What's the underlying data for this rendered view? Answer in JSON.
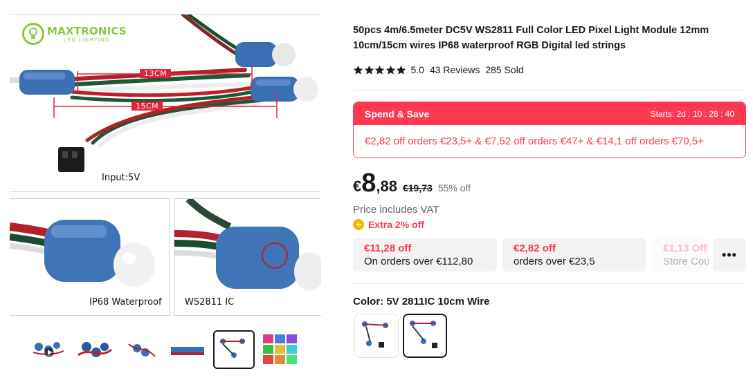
{
  "gallery": {
    "logo_name": "MAXTRONICS",
    "logo_sub": "LED LIGHTING",
    "dim_short": "13CM",
    "dim_long": "15CM",
    "input_caption": "Input:5V",
    "caption_left": "IP68 Waterproof",
    "caption_right": "WS2811 IC",
    "thumbnails": [
      {
        "name": "thumb-1",
        "video": true
      },
      {
        "name": "thumb-2"
      },
      {
        "name": "thumb-3"
      },
      {
        "name": "thumb-4"
      },
      {
        "name": "thumb-5",
        "active": true
      },
      {
        "name": "thumb-6"
      }
    ]
  },
  "product": {
    "title": "50pcs 4m/6.5meter DC5V WS2811 Full Color LED Pixel Light Module 12mm 10cm/15cm wires IP68 waterproof RGB Digital led strings",
    "rating": "5.0",
    "reviews": "43 Reviews",
    "sold": "285 Sold",
    "stars": 5
  },
  "promo": {
    "title": "Spend & Save",
    "timer": "Starts: 2d : 10 : 28 : 40",
    "body": "€2,82 off orders €23,5+ & €7,52 off orders €47+ & €14,1 off orders €70,5+"
  },
  "price": {
    "currency": "€",
    "integer": "8",
    "decimal": ",88",
    "original": "€19,73",
    "discount": "55% off",
    "vat_note": "Price includes VAT",
    "extra": "Extra 2% off"
  },
  "coupons": [
    {
      "value": "€11,28 off",
      "desc": "On orders over €112,80"
    },
    {
      "value": "€2,82 off",
      "desc": "orders over €23,5"
    },
    {
      "value": "€1,13 Off",
      "desc": "Store Cou"
    }
  ],
  "more_label": "•••",
  "color": {
    "label": "Color: 5V 2811IC 10cm Wire"
  },
  "colors": {
    "accent": "#fd384f",
    "brand_green": "#8cc63f",
    "text": "#191919"
  }
}
